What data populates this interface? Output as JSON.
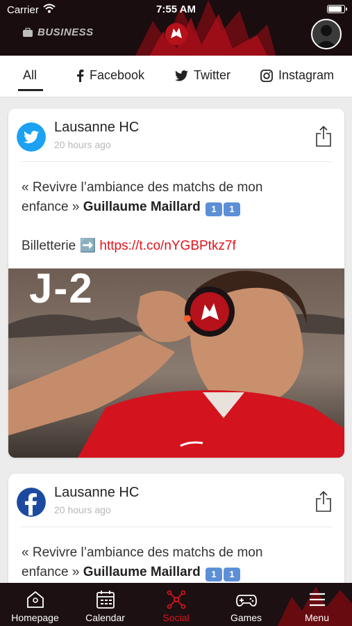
{
  "status_bar": {
    "carrier": "Carrier",
    "time": "7:55 AM",
    "battery_level": 0.9
  },
  "header": {
    "business_label": "BUSINESS"
  },
  "filters": [
    {
      "label": "All",
      "icon": "all"
    },
    {
      "label": "Facebook",
      "icon": "facebook-icon"
    },
    {
      "label": "Twitter",
      "icon": "twitter-icon"
    },
    {
      "label": "Instagram",
      "icon": "instagram-icon"
    }
  ],
  "posts": [
    {
      "source": "twitter-icon",
      "author": "Lausanne HC",
      "time_ago": "20 hours ago",
      "text_line1": "« Revivre l’ambiance des matchs de mon",
      "text_line2_plain": "enfance » ",
      "text_bold": "Guillaume Maillard",
      "emoji_1": "1",
      "emoji_2": "1",
      "ticket_label": "Billetterie",
      "ticket_emoji": "➡️",
      "link": "https://t.co/nYGBPtkz7f",
      "image_overlay": "J-2"
    },
    {
      "source": "facebook-icon",
      "author": "Lausanne HC",
      "time_ago": "20 hours ago",
      "text_line1": "« Revivre l’ambiance des matchs de mon",
      "text_line2_plain": "enfance » ",
      "text_bold": "Guillaume Maillard",
      "emoji_1": "1",
      "emoji_2": "1"
    }
  ],
  "bottom_nav": [
    {
      "label": "Homepage",
      "icon": "home-icon"
    },
    {
      "label": "Calendar",
      "icon": "calendar-icon"
    },
    {
      "label": "Social",
      "icon": "social-network-icon",
      "active": true
    },
    {
      "label": "Games",
      "icon": "gamepad-icon"
    },
    {
      "label": "Menu",
      "icon": "hamburger-menu-icon"
    }
  ],
  "colors": {
    "accent": "#e0141e",
    "header_bg": "#1a0d0f",
    "twitter": "#1da1f2",
    "facebook": "#1877f2"
  }
}
